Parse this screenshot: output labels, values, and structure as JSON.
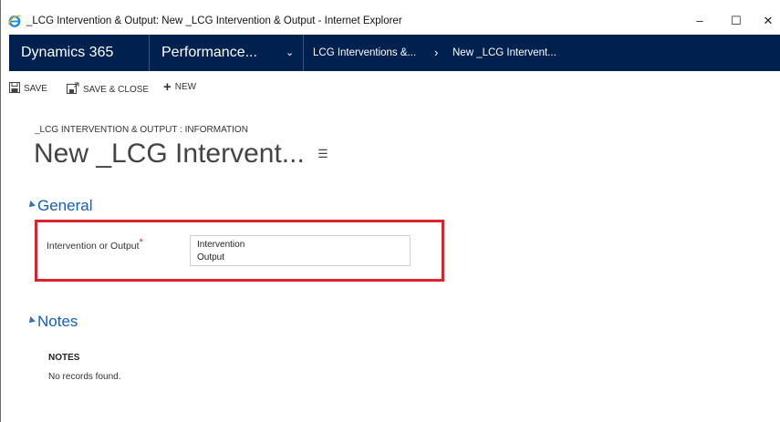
{
  "window": {
    "title": "_LCG Intervention & Output: New _LCG Intervention & Output - Internet Explorer",
    "minimize": "–",
    "maximize": "☐",
    "close": "✕"
  },
  "nav": {
    "app_name": "Dynamics 365",
    "area": "Performance...",
    "area_chevron": "⌄",
    "entity": "LCG Interventions &...",
    "breadcrumb_sep": "›",
    "record": "New _LCG Intervent..."
  },
  "toolbar": {
    "save_label": "SAVE",
    "save_close_label": "SAVE & CLOSE",
    "new_label": "NEW"
  },
  "form": {
    "entity_form_label": "_LCG INTERVENTION & OUTPUT : INFORMATION",
    "title": "New _LCG Intervent...",
    "menu_glyph": "☰"
  },
  "general": {
    "heading": "General",
    "field_label": "Intervention or Output",
    "required_marker": "*",
    "options": [
      "Intervention",
      "Output"
    ]
  },
  "notes": {
    "heading": "Notes",
    "subheading": "NOTES",
    "empty_text": "No records found."
  },
  "colors": {
    "nav_bg": "#002050",
    "section_heading": "#1160b7",
    "highlight": "#d9242f"
  }
}
